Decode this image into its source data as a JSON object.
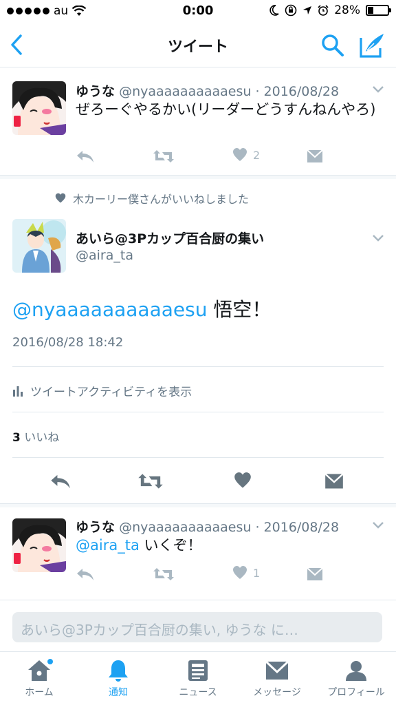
{
  "status": {
    "carrier": "au",
    "time": "0:00",
    "battery": "28%",
    "battery_level": 0.28
  },
  "nav": {
    "title": "ツイート"
  },
  "tweets": [
    {
      "name": "ゆうな",
      "meta": "@nyaaaaaaaaaaesu · 2016/08/28",
      "text": "ぜろーぐやるかい(リーダーどうすんねんやろ)",
      "like_count": "2"
    },
    {
      "name": "ゆうな",
      "meta": "@nyaaaaaaaaaaesu · 2016/08/28",
      "mention": "@aira_ta",
      "text": " いくぞ！",
      "like_count": "1"
    }
  ],
  "main": {
    "liked_note": "木カーリー僕さんがいいねしました",
    "name": "あいら@3Pカップ百合厨の集い",
    "handle": "@aira_ta",
    "mention": "@nyaaaaaaaaaaesu",
    "text": " 悟空！",
    "timestamp": "2016/08/28 18:42",
    "activity_label": "ツイートアクティビティを表示",
    "likes_number": "3",
    "likes_label": " いいね"
  },
  "reply": {
    "placeholder": "あいら@3Pカップ百合厨の集い, ゆうな に…"
  },
  "tabs": [
    {
      "label": "ホーム",
      "icon": "home-icon"
    },
    {
      "label": "通知",
      "icon": "bell-icon"
    },
    {
      "label": "ニュース",
      "icon": "news-icon"
    },
    {
      "label": "メッセージ",
      "icon": "message-icon"
    },
    {
      "label": "プロフィール",
      "icon": "profile-icon"
    }
  ],
  "colors": {
    "accent": "#1da1f2",
    "muted": "#657786",
    "icon_gray": "#aab8c2",
    "dark_icon": "#66757f"
  }
}
